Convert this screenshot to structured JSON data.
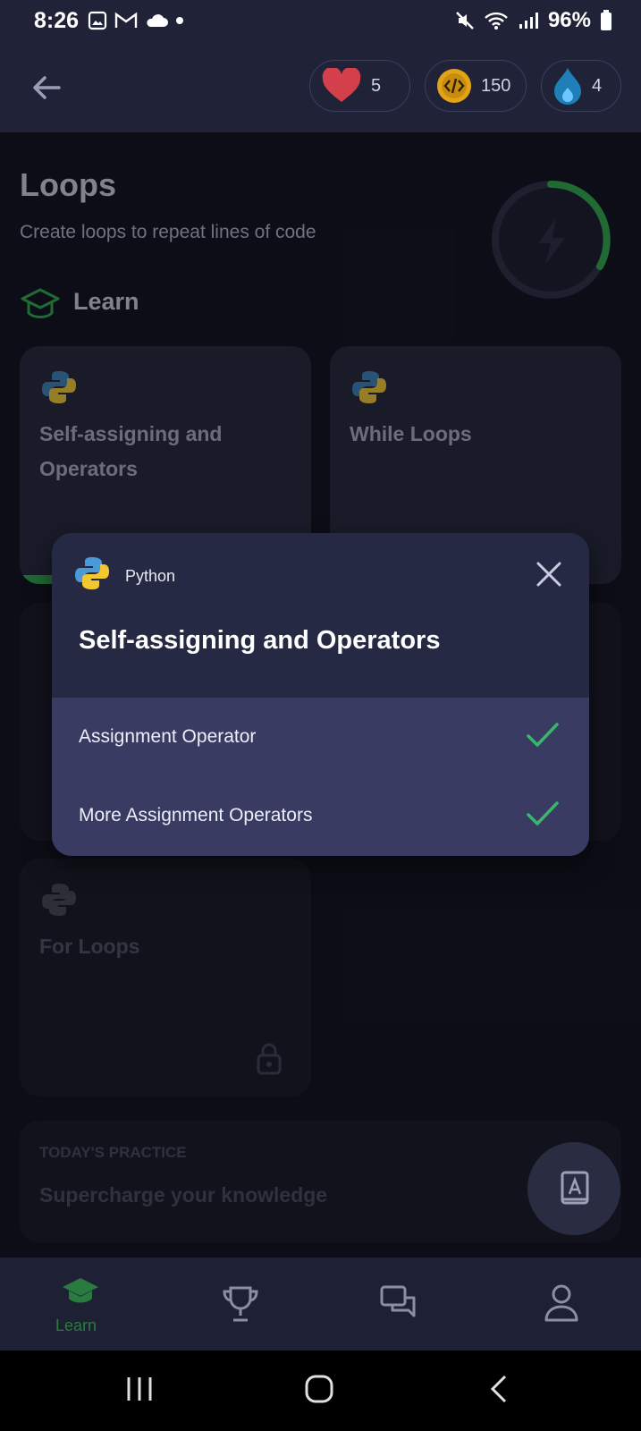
{
  "status_bar": {
    "time": "8:26",
    "battery": "96%"
  },
  "header": {
    "hearts": "5",
    "coins": "150",
    "streak": "4"
  },
  "page": {
    "title": "Loops",
    "subtitle": "Create loops to repeat lines of code",
    "section_label": "Learn"
  },
  "cards": [
    {
      "title_line1": "Self-assigning and",
      "title_line2": "Operators"
    },
    {
      "title_line1": "While Loops"
    },
    {
      "title_line1": "For Loops"
    }
  ],
  "practice": {
    "label": "TODAY'S PRACTICE",
    "title": "Supercharge your knowledge"
  },
  "modal": {
    "language": "Python",
    "title": "Self-assigning and Operators",
    "items": [
      {
        "label": "Assignment Operator",
        "completed": true
      },
      {
        "label": "More Assignment Operators",
        "completed": true
      }
    ]
  },
  "bottom_nav": {
    "learn_label": "Learn"
  },
  "colors": {
    "accent_green": "#2e9a4a",
    "check_green": "#3bb56c",
    "modal_bg": "#252943",
    "list_bg": "#393b63"
  }
}
